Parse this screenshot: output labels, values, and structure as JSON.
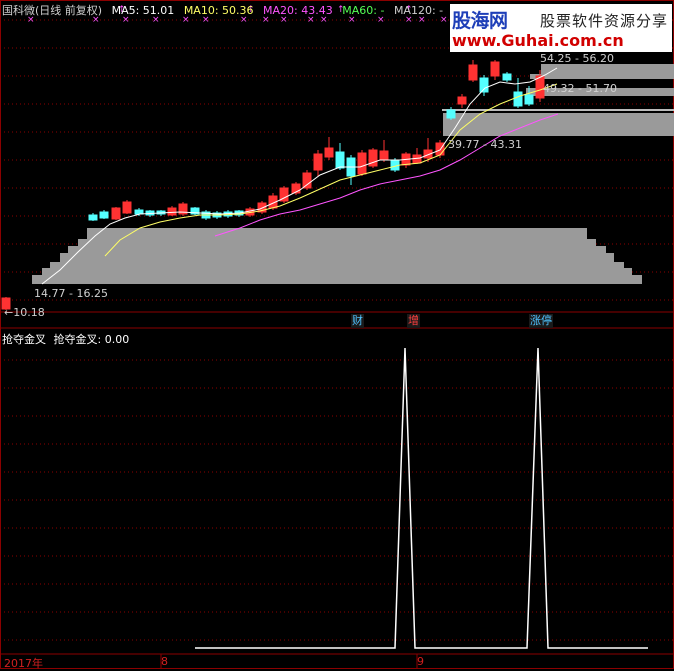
{
  "legend": [
    {
      "text": "国科微(日线 前复权)",
      "color": "#d0d0d0"
    },
    {
      "text": "MA5: 51.01",
      "color": "#ffffff"
    },
    {
      "text": "MA10: 50.36",
      "color": "#ffff66"
    },
    {
      "text": "MA20: 43.43",
      "color": "#ff55ff"
    },
    {
      "text": "MA60: -",
      "color": "#55ff55"
    },
    {
      "text": "MA120: -",
      "color": "#d0d0d0"
    }
  ],
  "logo": {
    "line1": "股海网",
    "line1b": "股票软件资源分享",
    "line2": "www.Guhai.com.cn"
  },
  "price_labels": [
    {
      "text": "54.25 - 56.20",
      "key": "z1"
    },
    {
      "text": "49.32 - 51.70",
      "key": "z2"
    },
    {
      "text": "39.77 - 43.31",
      "key": "z3"
    },
    {
      "text": "14.77 - 16.25",
      "key": "z4"
    },
    {
      "text": "←10.18",
      "key": "low"
    }
  ],
  "events": [
    {
      "text": "财",
      "color": "#4fc3ff"
    },
    {
      "text": "增",
      "color": "#ff4040"
    },
    {
      "text": "涨停",
      "color": "#4fc3ff"
    }
  ],
  "indicator": {
    "name": "抢夺金叉",
    "label": "抢夺金叉: 0.00"
  },
  "x_labels": [
    {
      "text": "2017年"
    },
    {
      "text": "8"
    },
    {
      "text": "9"
    }
  ],
  "colors": {
    "up": "#ff3232",
    "down": "#54ffff",
    "ma5": "#ffffff",
    "ma10": "#ffff66",
    "ma20": "#ff55ff",
    "zone": "#9a9a9a",
    "grid": "#8b0000"
  }
}
